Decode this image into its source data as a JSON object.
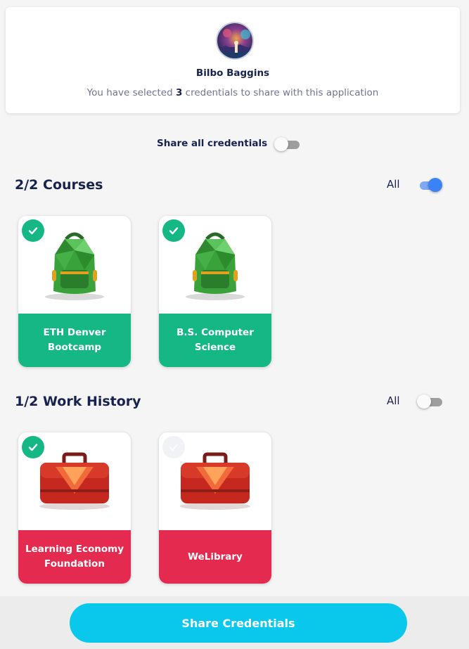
{
  "header": {
    "user_name": "Bilbo Baggins",
    "selected_prefix": "You have selected",
    "selected_count": "3",
    "selected_suffix": "credentials to share with this application"
  },
  "share_all": {
    "label": "Share all credentials",
    "enabled": false
  },
  "sections": [
    {
      "title": "2/2 Courses",
      "all_label": "All",
      "all_enabled": true,
      "items": [
        {
          "label": "ETH Denver Bootcamp",
          "selected": true,
          "icon": "green-backpack-icon"
        },
        {
          "label": "B.S. Computer Science",
          "selected": true,
          "icon": "green-backpack-icon"
        }
      ]
    },
    {
      "title": "1/2 Work History",
      "all_label": "All",
      "all_enabled": false,
      "items": [
        {
          "label": "Learning Economy Foundation",
          "selected": true,
          "icon": "red-briefcase-icon"
        },
        {
          "label": "WeLibrary",
          "selected": false,
          "icon": "red-briefcase-icon"
        }
      ]
    }
  ],
  "action": {
    "share_label": "Share Credentials"
  },
  "colors": {
    "accent": "#0ac8ec",
    "course_footer": "#15b884",
    "work_footer": "#e42a4e",
    "toggle_on": "#3b82f6",
    "text": "#18224e"
  }
}
